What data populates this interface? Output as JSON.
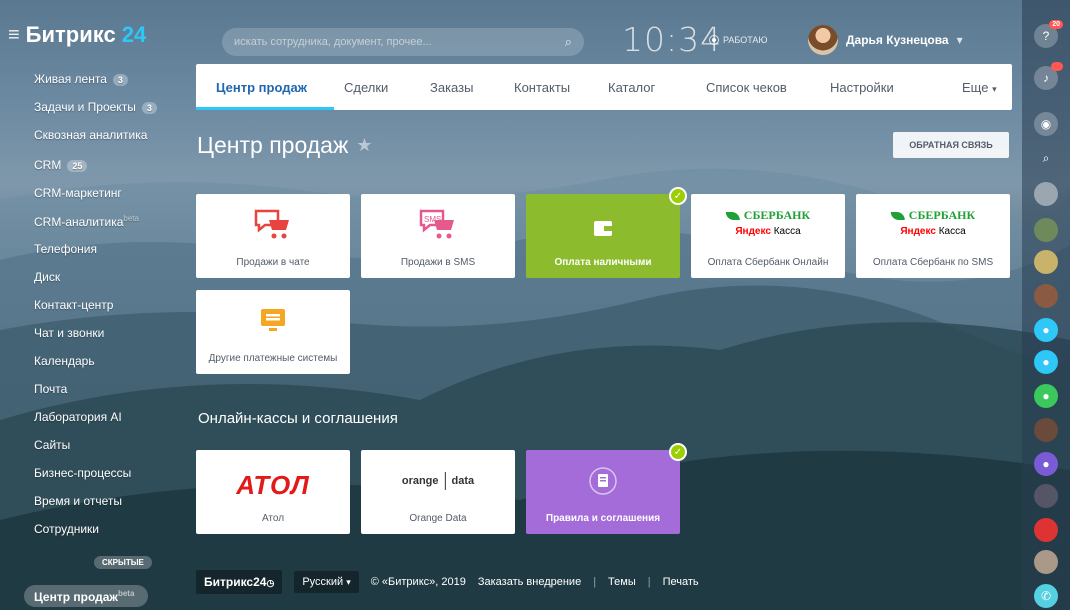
{
  "header": {
    "logo_text": "Битрикс",
    "logo_num": "24",
    "search_placeholder": "искать сотрудника, документ, прочее...",
    "clock": "10:34",
    "status": "РАБОТАЮ",
    "user_name": "Дарья Кузнецова"
  },
  "sidebar": {
    "items": [
      {
        "label": "Живая лента",
        "count": "3"
      },
      {
        "label": "Задачи и Проекты",
        "count": "3"
      },
      {
        "label": "Сквозная аналитика"
      },
      {
        "label": "CRM",
        "count": "25"
      },
      {
        "label": "CRM-маркетинг"
      },
      {
        "label": "CRM-аналитика",
        "sup": "beta"
      },
      {
        "label": "Телефония"
      },
      {
        "label": "Диск"
      },
      {
        "label": "Контакт-центр"
      },
      {
        "label": "Чат и звонки"
      },
      {
        "label": "Календарь"
      },
      {
        "label": "Почта"
      },
      {
        "label": "Лаборатория AI"
      },
      {
        "label": "Сайты"
      },
      {
        "label": "Бизнес-процессы"
      },
      {
        "label": "Время и отчеты"
      },
      {
        "label": "Сотрудники"
      }
    ],
    "hidden_label": "СКРЫТЫЕ",
    "active_label": "Центр продаж",
    "active_sup": "beta"
  },
  "tabs": [
    {
      "label": "Центр продаж"
    },
    {
      "label": "Сделки"
    },
    {
      "label": "Заказы"
    },
    {
      "label": "Контакты"
    },
    {
      "label": "Каталог"
    },
    {
      "label": "Список чеков"
    },
    {
      "label": "Настройки"
    },
    {
      "label": "Еще"
    }
  ],
  "page": {
    "title": "Центр продаж",
    "feedback_label": "ОБРАТНАЯ СВЯЗЬ",
    "section_title": "Онлайн-кассы и соглашения"
  },
  "tiles": {
    "chat": "Продажи в чате",
    "sms": "Продажи в SMS",
    "cash": "Оплата наличными",
    "sber_online": "Оплата Сбербанк Онлайн",
    "sber_sms": "Оплата Сбербанк по SMS",
    "sber_logo": "СБЕРБАНК",
    "yandex_logo_a": "Яндекс",
    "yandex_logo_b": "Касса",
    "sms_icon_text": "SMS",
    "other": "Другие платежные системы",
    "atol": "Атол",
    "atol_logo": "АТОЛ",
    "orange": "Orange Data",
    "orange_logo_a": "orange",
    "orange_logo_b": "data",
    "rules": "Правила и соглашения"
  },
  "footer": {
    "brand": "Битрикс24",
    "lang": "Русский",
    "copyright": "© «Битрикс», 2019",
    "order": "Заказать внедрение",
    "themes": "Темы",
    "print": "Печать"
  },
  "rail": {
    "notif_count": "20",
    "colors": {
      "accent": "#2fc7f7",
      "green": "#8cbc2e",
      "purple": "#a46cd9",
      "badge": "#ff5752"
    }
  }
}
